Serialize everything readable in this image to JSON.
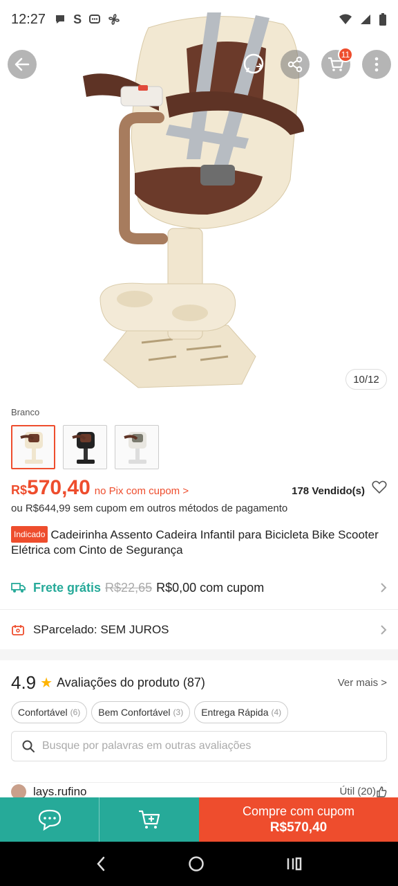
{
  "status_bar": {
    "time": "12:27",
    "icons": [
      "chat-bubble-icon",
      "s-app-icon",
      "message-icon",
      "fan-icon"
    ],
    "right_icons": [
      "wifi-icon",
      "signal-icon",
      "battery-icon"
    ],
    "s_glyph": "S"
  },
  "top_actions": {
    "cart_badge": "11"
  },
  "hero": {
    "image_counter": "10/12"
  },
  "variants": {
    "label": "Branco",
    "count": 3,
    "selected_index": 0
  },
  "price": {
    "currency": "R$",
    "value": "570,40",
    "pix_note": "no Pix com cupom >",
    "sold": "178 Vendido(s)",
    "alt_text": "ou R$644,99 sem cupom em outros métodos de pagamento"
  },
  "product": {
    "tag": "Indicado",
    "title": "Cadeirinha Assento Cadeira Infantil para Bicicleta Bike Scooter Elétrica com Cinto de Segurança"
  },
  "shipping": {
    "label": "Frete grátis",
    "old_price": "R$22,65",
    "new_price": "R$0,00 com cupom"
  },
  "installments": {
    "label": "SParcelado: SEM JUROS"
  },
  "reviews": {
    "rating": "4.9",
    "title": "Avaliações do produto (87)",
    "see_more": "Ver mais >",
    "chips": [
      {
        "label": "Confortável",
        "count": "(6)"
      },
      {
        "label": "Bem Confortável",
        "count": "(3)"
      },
      {
        "label": "Entrega Rápida",
        "count": "(4)"
      }
    ],
    "search_placeholder": "Busque por palavras em outras avaliações",
    "first_reviewer": "lays.rufino",
    "helpful": "Útil (20)"
  },
  "bottom_bar": {
    "buy_label": "Compre com cupom",
    "buy_price": "R$570,40"
  },
  "colors": {
    "brand": "#ee4d2d",
    "teal": "#26aa99"
  }
}
